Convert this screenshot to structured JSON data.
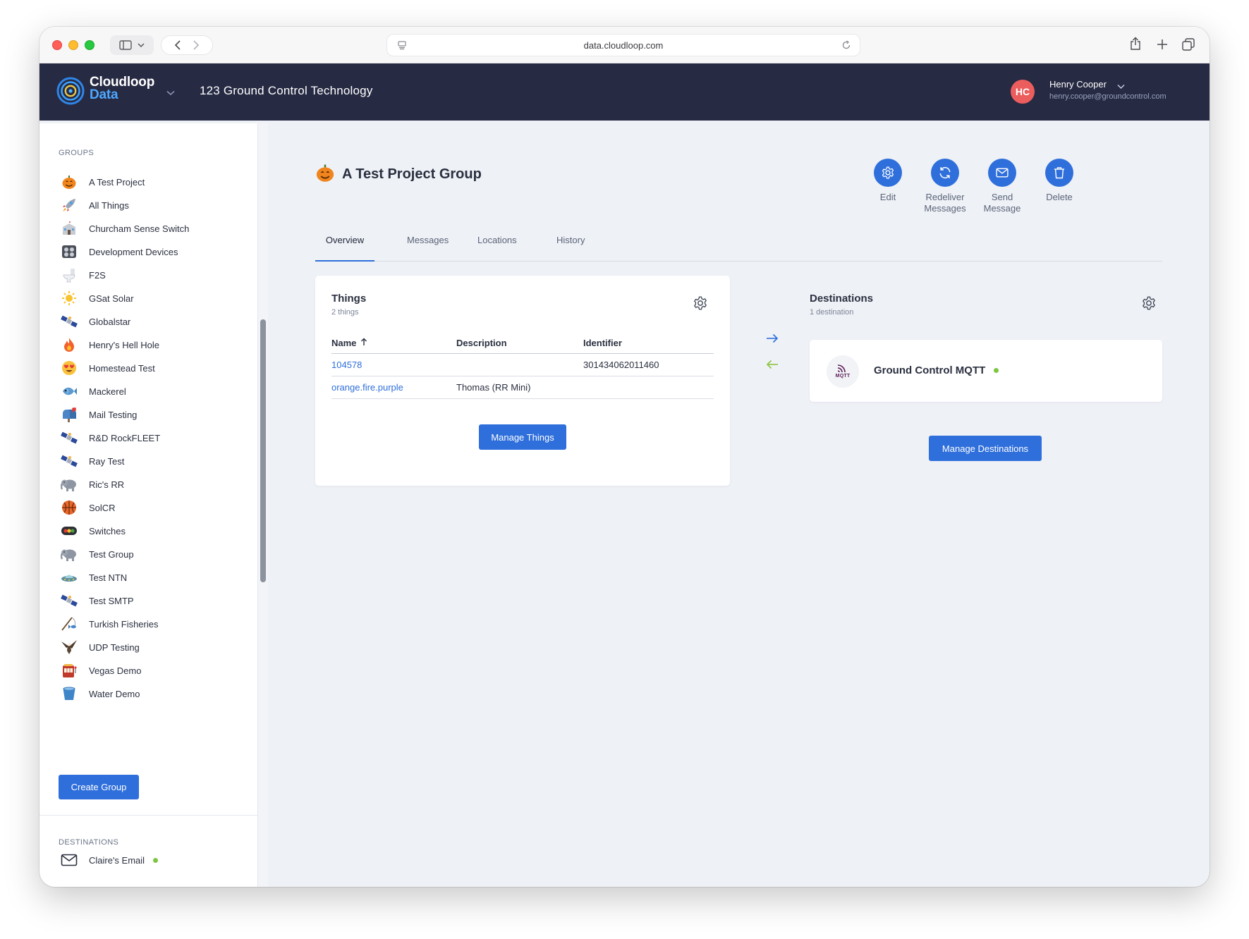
{
  "browser": {
    "url": "data.cloudloop.com"
  },
  "header": {
    "logo_line1": "Cloudloop",
    "logo_line2": "Data",
    "org_name": "123 Ground Control Technology",
    "user": {
      "initials": "HC",
      "name": "Henry Cooper",
      "email": "henry.cooper@groundcontrol.com",
      "avatar_color": "#ec5d5d"
    }
  },
  "sidebar": {
    "groups_heading": "GROUPS",
    "groups": [
      {
        "label": "A Test Project",
        "icon": "pumpkin-icon"
      },
      {
        "label": "All Things",
        "icon": "rocket-icon"
      },
      {
        "label": "Churcham Sense Switch",
        "icon": "school-icon"
      },
      {
        "label": "Development Devices",
        "icon": "control-knobs-icon"
      },
      {
        "label": "F2S",
        "icon": "toilet-icon"
      },
      {
        "label": "GSat Solar",
        "icon": "sun-icon"
      },
      {
        "label": "Globalstar",
        "icon": "satellite-icon"
      },
      {
        "label": "Henry's Hell Hole",
        "icon": "fire-icon"
      },
      {
        "label": "Homestead Test",
        "icon": "heart-eyes-icon"
      },
      {
        "label": "Mackerel",
        "icon": "fish-icon"
      },
      {
        "label": "Mail Testing",
        "icon": "mailbox-icon"
      },
      {
        "label": "R&D RockFLEET",
        "icon": "satellite-icon"
      },
      {
        "label": "Ray Test",
        "icon": "satellite-icon"
      },
      {
        "label": "Ric's RR",
        "icon": "elephant-icon"
      },
      {
        "label": "SolCR",
        "icon": "basketball-icon"
      },
      {
        "label": "Switches",
        "icon": "traffic-light-icon"
      },
      {
        "label": "Test Group",
        "icon": "elephant-icon"
      },
      {
        "label": "Test NTN",
        "icon": "ufo-icon"
      },
      {
        "label": "Test SMTP",
        "icon": "satellite-icon"
      },
      {
        "label": "Turkish Fisheries",
        "icon": "fishing-pole-icon"
      },
      {
        "label": "UDP Testing",
        "icon": "eagle-icon"
      },
      {
        "label": "Vegas Demo",
        "icon": "slot-machine-icon"
      },
      {
        "label": "Water Demo",
        "icon": "bucket-icon"
      }
    ],
    "create_group_label": "Create Group",
    "destinations_heading": "DESTINATIONS",
    "destinations": [
      {
        "label": "Claire's Email",
        "icon": "envelope-icon",
        "status_color": "#7ec641"
      }
    ]
  },
  "page": {
    "title": "A Test Project Group",
    "title_icon": "pumpkin-icon",
    "actions": [
      {
        "label": "Edit",
        "icon": "gear-icon"
      },
      {
        "label": "Redeliver Messages",
        "icon": "refresh-icon"
      },
      {
        "label": "Send Message",
        "icon": "envelope-icon"
      },
      {
        "label": "Delete",
        "icon": "trash-icon"
      }
    ],
    "tabs": [
      "Overview",
      "Messages",
      "Locations",
      "History"
    ],
    "active_tab": "Overview"
  },
  "things": {
    "title": "Things",
    "subtitle": "2 things",
    "columns": [
      "Name",
      "Description",
      "Identifier"
    ],
    "sort_column": "Name",
    "rows": [
      {
        "name": "104578",
        "description": "",
        "identifier": "301434062011460"
      },
      {
        "name": "orange.fire.purple",
        "description": "Thomas (RR Mini)",
        "identifier": ""
      }
    ],
    "manage_label": "Manage Things"
  },
  "destinations": {
    "title": "Destinations",
    "subtitle": "1 destination",
    "items": [
      {
        "name": "Ground Control MQTT",
        "logo_text": "MQTT",
        "status_color": "#7ec641"
      }
    ],
    "manage_label": "Manage Destinations"
  },
  "colors": {
    "accent": "#2f6fdb",
    "header_bg": "#262a43",
    "status_ok": "#7ec641",
    "inbound_arrow": "#8cc63f"
  }
}
